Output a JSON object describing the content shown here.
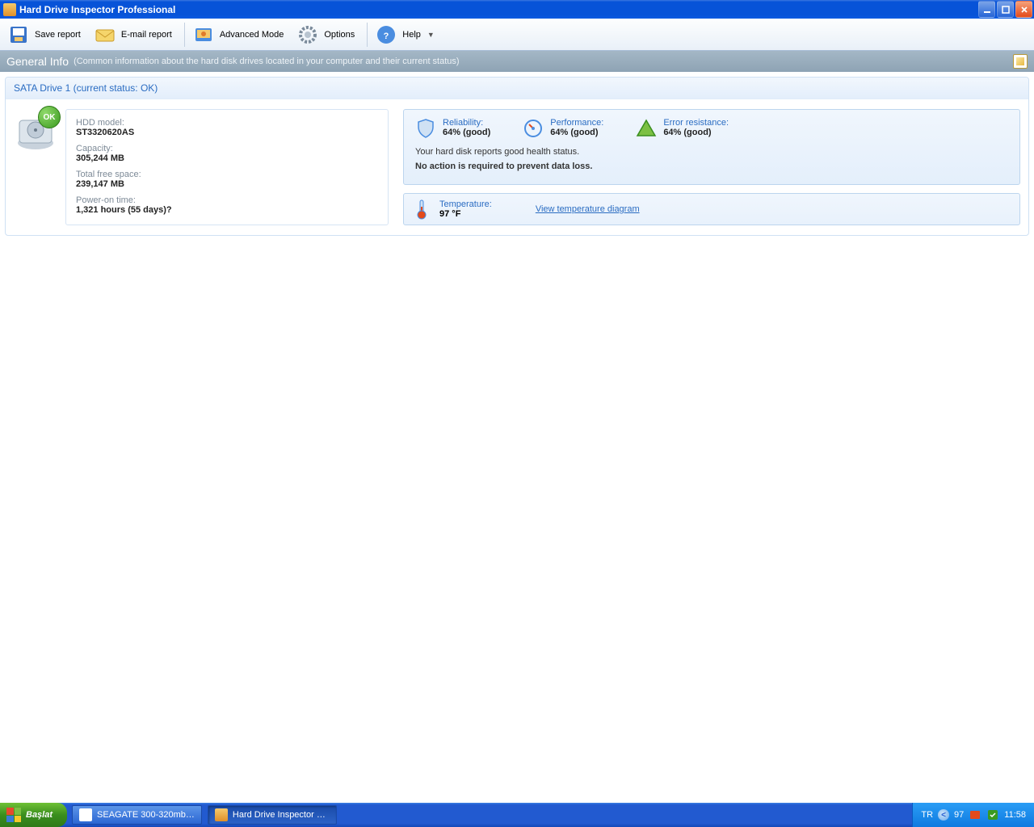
{
  "window": {
    "title": "Hard Drive Inspector Professional"
  },
  "toolbar": {
    "save_report": "Save report",
    "email_report": "E-mail report",
    "advanced_mode": "Advanced Mode",
    "options": "Options",
    "help": "Help"
  },
  "infobar": {
    "label": "General Info",
    "desc": "(Common information about the hard disk drives located in your computer and their current status)"
  },
  "drive": {
    "header": "SATA Drive 1 (current status: OK)",
    "ok_badge": "OK",
    "model_label": "HDD model:",
    "model_value": "ST3320620AS",
    "capacity_label": "Capacity:",
    "capacity_value": "305,244 MB",
    "free_label": "Total free space:",
    "free_value": "239,147 MB",
    "poweron_label": "Power-on time:",
    "poweron_value": "1,321 hours (55 days)?"
  },
  "metrics": {
    "reliability_label": "Reliability:",
    "reliability_value": "64% (good)",
    "performance_label": "Performance:",
    "performance_value": "64% (good)",
    "error_label": "Error resistance:",
    "error_value": "64% (good)"
  },
  "status": {
    "line1": "Your hard disk reports good health status.",
    "line2": "No action is required to prevent data loss."
  },
  "temperature": {
    "label": "Temperature:",
    "value": "97 °F",
    "link": "View temperature diagram"
  },
  "taskbar": {
    "start": "Başlat",
    "task1": "SEAGATE 300-320mb…",
    "task2": "Hard Drive Inspector …",
    "lang": "TR",
    "tray_temp": "97",
    "clock": "11:58"
  }
}
